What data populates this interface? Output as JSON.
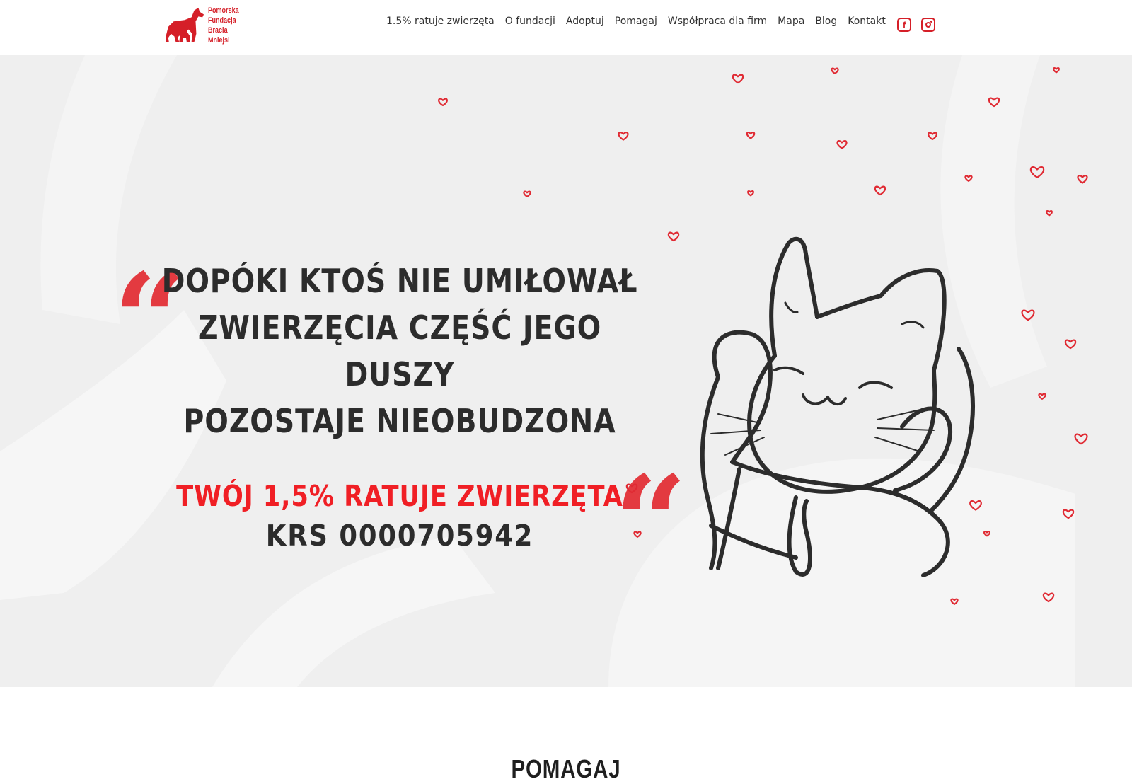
{
  "brand": {
    "logo_lines": [
      "Pomorska",
      "Fundacja",
      "Bracia",
      "Mniejsi"
    ],
    "color": "#d51f28"
  },
  "nav": {
    "items": [
      {
        "label": "1.5% ratuje zwierzęta"
      },
      {
        "label": "O fundacji"
      },
      {
        "label": "Adoptuj"
      },
      {
        "label": "Pomagaj"
      },
      {
        "label": "Współpraca dla firm"
      },
      {
        "label": "Mapa"
      },
      {
        "label": "Blog"
      },
      {
        "label": "Kontakt"
      }
    ],
    "social": {
      "facebook_icon": "facebook-icon",
      "instagram_icon": "instagram-icon",
      "facebook_glyph": "f"
    }
  },
  "hero": {
    "quote_lines": [
      "DOPÓKI KTOŚ NIE UMIŁOWAŁ",
      "ZWIERZĘCIA CZĘŚĆ JEGO DUSZY",
      "POZOSTAJE NIEOBUDZONA"
    ],
    "quote_open_mark": "”",
    "quote_close_mark": "”",
    "cta": "TWÓJ 1,5% RATUJE ZWIERZĘTA",
    "krs": "KRS 0000705942",
    "illustration": "cat-hugged-by-hands-illustration",
    "accent_color": "#f01f25",
    "heart_color": "#e02a33",
    "background": "#efefef"
  },
  "section": {
    "title": "POMAGAJ"
  }
}
